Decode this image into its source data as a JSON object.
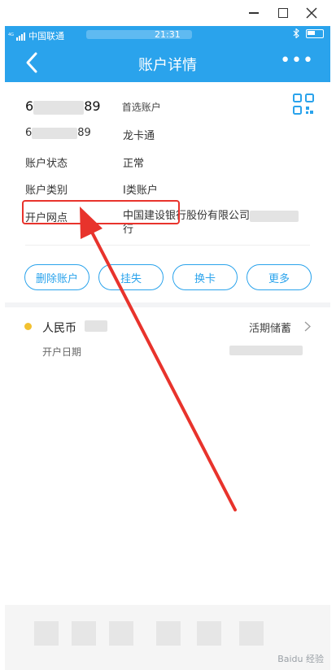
{
  "status_bar": {
    "carrier": "中国联通",
    "time": "21:31"
  },
  "nav": {
    "title": "账户详情",
    "more_label": "•••"
  },
  "account": {
    "primary_number_prefix": "6",
    "primary_number_suffix": "89",
    "primary_tag": "首选账户",
    "card_number_prefix": "6",
    "card_number_suffix": "89",
    "card_name": "龙卡通",
    "status_label": "账户状态",
    "status_value": "正常",
    "type_label": "账户类别",
    "type_value": "I类账户",
    "branch_label": "开户网点",
    "branch_value_line1": "中国建设银行股份有限公司",
    "branch_value_line2": "行"
  },
  "actions": [
    {
      "label": "删除账户"
    },
    {
      "label": "挂失"
    },
    {
      "label": "换卡"
    },
    {
      "label": "更多"
    }
  ],
  "sub_account": {
    "currency": "人民币",
    "deposit_type": "活期储蓄",
    "open_date_label": "开户日期"
  },
  "watermark": "Baidu 经验",
  "colors": {
    "primary": "#2aa3ec",
    "annotation": "#e8332c",
    "dot": "#f2c130"
  }
}
